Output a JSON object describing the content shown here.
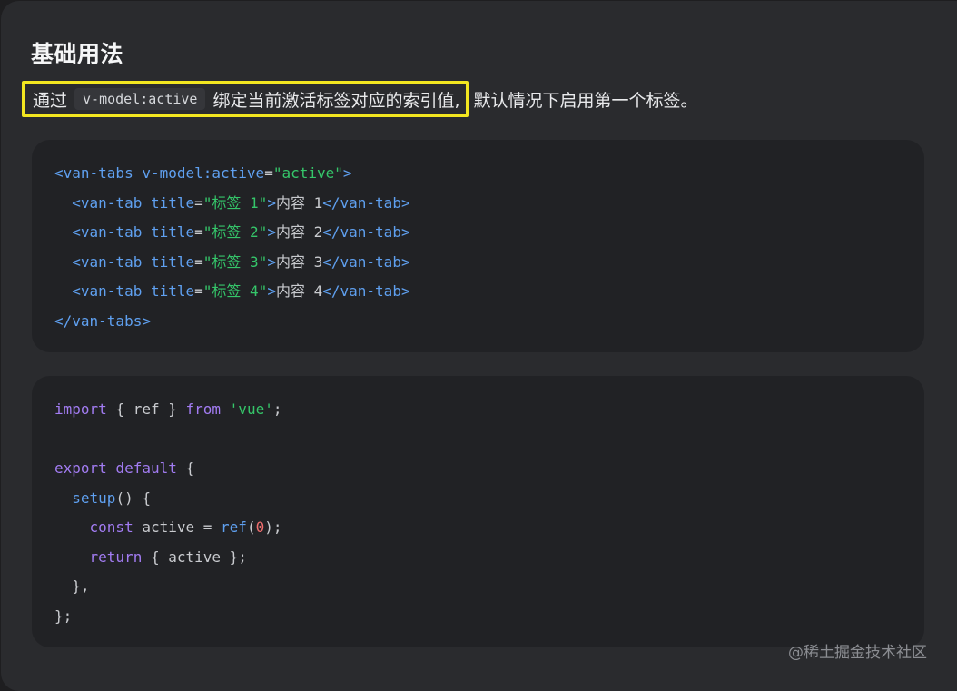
{
  "section": {
    "title": "基础用法"
  },
  "description": {
    "highlight_prefix": "通过",
    "inline_code": "v-model:active",
    "highlight_suffix": "绑定当前激活标签对应的索引值,",
    "rest": "默认情况下启用第一个标签。",
    "highlight_color": "#f2e620"
  },
  "template_code": {
    "line1": {
      "open": "<van-tabs ",
      "attr": "v-model:active",
      "eq": "=",
      "val": "\"active\"",
      "close": ">"
    },
    "tab_lines": [
      {
        "open": "<van-tab ",
        "attr": "title",
        "eq": "=",
        "val": "\"标签 1\"",
        "close": ">",
        "content": "内容 1",
        "end": "</van-tab>"
      },
      {
        "open": "<van-tab ",
        "attr": "title",
        "eq": "=",
        "val": "\"标签 2\"",
        "close": ">",
        "content": "内容 2",
        "end": "</van-tab>"
      },
      {
        "open": "<van-tab ",
        "attr": "title",
        "eq": "=",
        "val": "\"标签 3\"",
        "close": ">",
        "content": "内容 3",
        "end": "</van-tab>"
      },
      {
        "open": "<van-tab ",
        "attr": "title",
        "eq": "=",
        "val": "\"标签 4\"",
        "close": ">",
        "content": "内容 4",
        "end": "</van-tab>"
      }
    ],
    "last_line": "</van-tabs>"
  },
  "script_code": {
    "import_kw": "import",
    "import_braces": " { ref } ",
    "from_kw": "from",
    "module": "'vue'",
    "semicolon": ";",
    "export_kw": "export default",
    "export_brace": " {",
    "setup_fn": "setup",
    "setup_rest": "() {",
    "const_kw": "const",
    "const_var": " active = ",
    "ref_fn": "ref",
    "paren_open": "(",
    "zero": "0",
    "paren_close": ");",
    "return_kw": "return",
    "return_rest": " { active };",
    "close1": "},",
    "close2": "};"
  },
  "watermark": "@稀土掘金技术社区"
}
